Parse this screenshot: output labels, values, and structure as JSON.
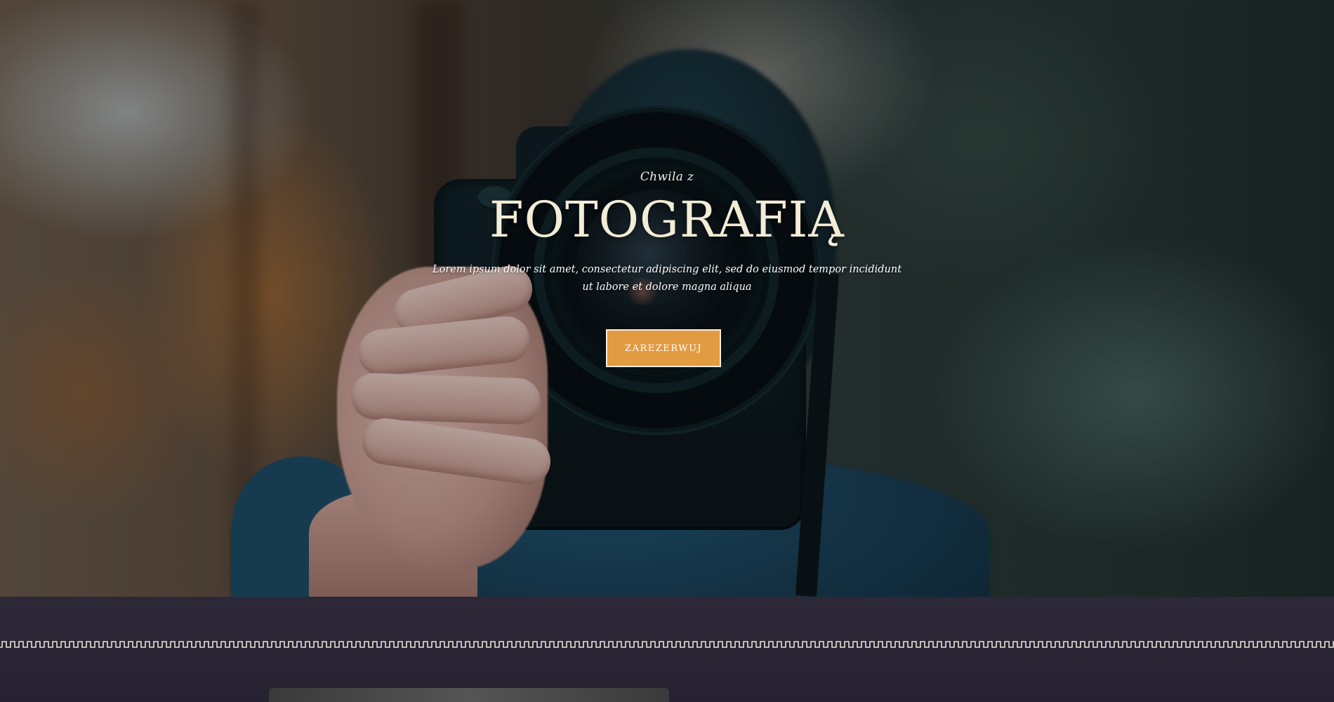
{
  "hero": {
    "eyebrow": "Chwila z",
    "headline": "FOTOGRAFIĄ",
    "lead": "Lorem ipsum dolor sit amet, consectetur adipiscing elit, sed do eiusmod tempor incididunt ut labore et dolore magna aliqua",
    "cta_label": "ZAREZERWUJ",
    "accent_color": "#e39b41",
    "headline_color": "#f3ecd6"
  },
  "band": {
    "background_color": "#27232f",
    "ornament_color": "#e8e2d4"
  }
}
